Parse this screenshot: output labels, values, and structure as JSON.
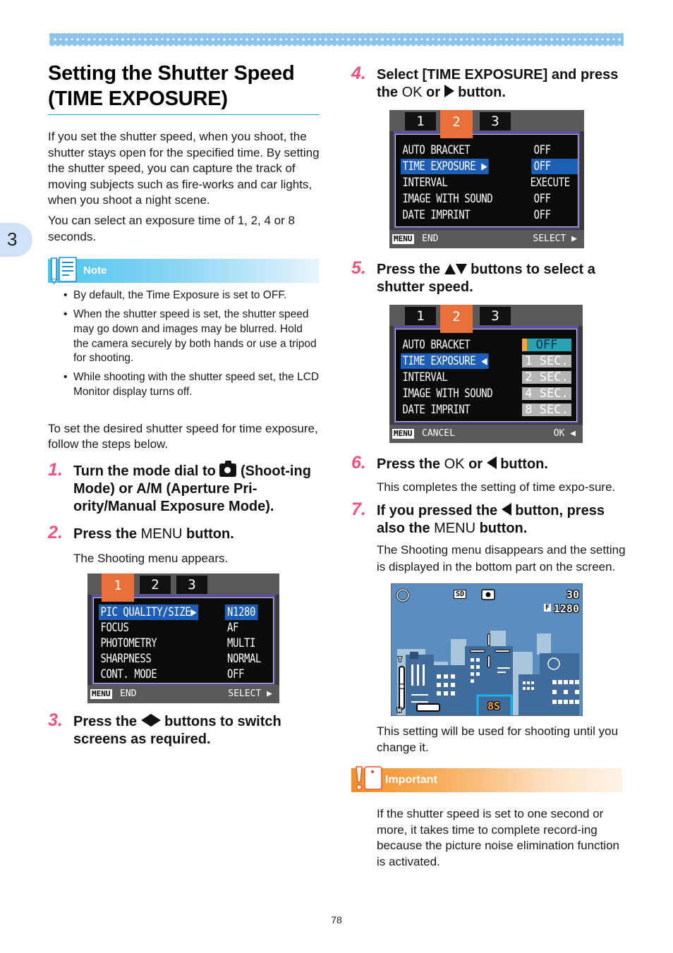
{
  "chapter_tab": "3",
  "page_number": "78",
  "title": "Setting the Shutter Speed (TIME EXPOSURE)",
  "intro": {
    "paragraph1": "If you set the shutter speed, when you shoot, the shutter stays open for the specified time. By setting the shutter speed, you can capture the track of moving subjects such as fire-works and car lights, when you shoot a night scene.",
    "paragraph2": "You can select an exposure time of 1, 2, 4 or 8 seconds."
  },
  "note": {
    "label": "Note",
    "items": [
      "By default, the Time Exposure is set to OFF.",
      "When the shutter speed is set, the shutter speed may go down and images may be blurred. Hold the camera securely by both hands or use a tripod for shooting.",
      "While shooting with the shutter speed set, the LCD Monitor display turns off."
    ]
  },
  "steps_intro": "To set the desired shutter speed for time exposure, follow the steps below.",
  "steps": [
    {
      "num": "1.",
      "text_a": "Turn the mode dial to ",
      "icon": "camera-icon",
      "text_b": " (Shoot-ing Mode) or A/M (Aperture Pri-ority/Manual Exposure Mode)."
    },
    {
      "num": "2.",
      "text_a": "Press the ",
      "key": "MENU",
      "text_b": " button.",
      "desc": "The Shooting menu appears."
    },
    {
      "num": "3.",
      "text_a": "Press the ",
      "icon": "left-right-arrows-icon",
      "text_b": " buttons to switch screens as required."
    },
    {
      "num": "4.",
      "text_a": "Select [TIME EXPOSURE] and press the ",
      "key": "OK",
      "text_mid": " or ",
      "icon": "right-arrow-icon",
      "text_b": " button."
    },
    {
      "num": "5.",
      "text_a": "Press the ",
      "icon": "up-down-arrows-icon",
      "text_b": " buttons to select a shutter speed."
    },
    {
      "num": "6.",
      "text_a": "Press the ",
      "key": "OK",
      "text_mid": " or ",
      "icon": "left-arrow-icon",
      "text_b": " button.",
      "desc": "This completes the setting of time expo-sure."
    },
    {
      "num": "7.",
      "text_a": "If you pressed the ",
      "icon": "left-arrow-icon",
      "text_b": " button, press also the ",
      "key": "MENU",
      "text_c": " button.",
      "desc": "The Shooting menu disappears and the setting is displayed in the bottom part on the screen.",
      "desc2": "This setting will be used for shooting until you change it."
    }
  ],
  "screen_menu1": {
    "tabs": [
      "1",
      "2",
      "3"
    ],
    "active_tab": "1",
    "rows": [
      {
        "label": "PIC QUALITY/SIZE▶",
        "value": "N1280",
        "selected": true
      },
      {
        "label": "FOCUS",
        "value": "AF"
      },
      {
        "label": "PHOTOMETRY",
        "value": "MULTI"
      },
      {
        "label": "SHARPNESS",
        "value": "NORMAL"
      },
      {
        "label": "CONT. MODE",
        "value": "OFF"
      }
    ],
    "footer_menu": "MENU",
    "footer_left": "END",
    "footer_right": "SELECT ▶"
  },
  "screen_menu2": {
    "tabs": [
      "1",
      "2",
      "3"
    ],
    "active_tab": "2",
    "rows": [
      {
        "label": "AUTO BRACKET",
        "value": "OFF"
      },
      {
        "label": "TIME EXPOSURE  ▶",
        "value": "OFF",
        "selected": true
      },
      {
        "label": "INTERVAL",
        "value": "EXECUTE"
      },
      {
        "label": "IMAGE WITH SOUND",
        "value": "OFF"
      },
      {
        "label": "DATE IMPRINT",
        "value": "OFF"
      }
    ],
    "footer_menu": "MENU",
    "footer_left": "END",
    "footer_right": "SELECT ▶"
  },
  "screen_menu3": {
    "tabs": [
      "1",
      "2",
      "3"
    ],
    "active_tab": "2",
    "rows": [
      {
        "label": "AUTO BRACKET"
      },
      {
        "label": "TIME EXPOSURE  ◀",
        "selected": true
      },
      {
        "label": "INTERVAL"
      },
      {
        "label": "IMAGE WITH SOUND"
      },
      {
        "label": "DATE IMPRINT"
      }
    ],
    "options": [
      "OFF",
      "1 SEC.",
      "2 SEC.",
      "4 SEC.",
      "8 SEC."
    ],
    "current_option": "OFF",
    "footer_menu": "MENU",
    "footer_left": "CANCEL",
    "footer_right": "OK ◀"
  },
  "screen_live": {
    "remaining_shots": "30",
    "image_size": "1280",
    "quality_badge": "F",
    "storage": "SD",
    "zoom_top": "T",
    "zoom_bottom": "W",
    "shutter_setting": "8S"
  },
  "important": {
    "label": "Important",
    "text": "If the shutter speed is set to one second or more, it takes time to complete record-ing because the picture noise elimination function is activated."
  }
}
